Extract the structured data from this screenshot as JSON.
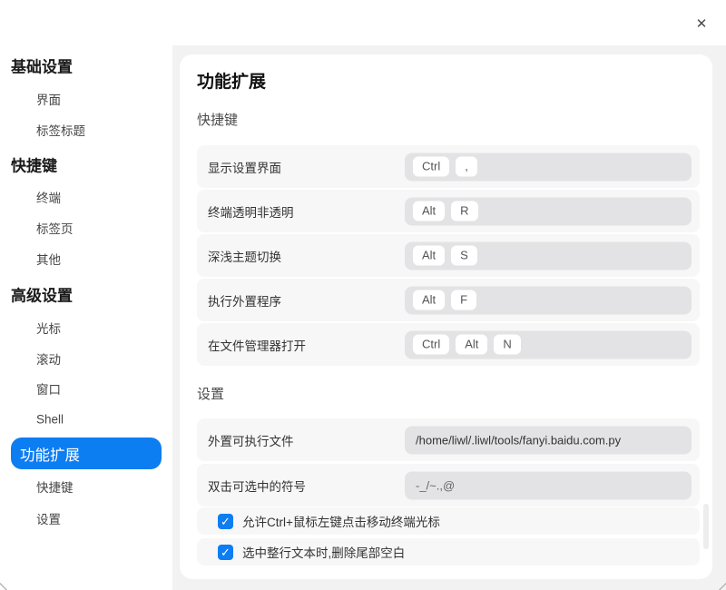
{
  "icons": {
    "close": "✕",
    "check": "✓"
  },
  "colors": {
    "accent": "#0d7df2",
    "row_bg": "#f7f7f8",
    "field_bg": "#e3e3e5",
    "backdrop": "#f2f2f3"
  },
  "sidebar": {
    "items": [
      {
        "label": "基础设置",
        "type": "header"
      },
      {
        "label": "界面",
        "type": "item"
      },
      {
        "label": "标签标题",
        "type": "item"
      },
      {
        "label": "快捷键",
        "type": "header"
      },
      {
        "label": "终端",
        "type": "item"
      },
      {
        "label": "标签页",
        "type": "item"
      },
      {
        "label": "其他",
        "type": "item"
      },
      {
        "label": "高级设置",
        "type": "header"
      },
      {
        "label": "光标",
        "type": "item"
      },
      {
        "label": "滚动",
        "type": "item"
      },
      {
        "label": "窗口",
        "type": "item"
      },
      {
        "label": "Shell",
        "type": "item"
      },
      {
        "label": "功能扩展",
        "type": "selected"
      },
      {
        "label": "快捷键",
        "type": "item"
      },
      {
        "label": "设置",
        "type": "item"
      }
    ]
  },
  "main": {
    "title": "功能扩展",
    "shortcuts_section_title": "快捷键",
    "shortcuts": [
      {
        "label": "显示设置界面",
        "keys": [
          "Ctrl",
          ","
        ]
      },
      {
        "label": "终端透明非透明",
        "keys": [
          "Alt",
          "R"
        ]
      },
      {
        "label": "深浅主题切换",
        "keys": [
          "Alt",
          "S"
        ]
      },
      {
        "label": "执行外置程序",
        "keys": [
          "Alt",
          "F"
        ]
      },
      {
        "label": "在文件管理器打开",
        "keys": [
          "Ctrl",
          "Alt",
          "N"
        ]
      }
    ],
    "settings_section_title": "设置",
    "settings": [
      {
        "label": "外置可执行文件",
        "value": "/home/liwl/.liwl/tools/fanyi.baidu.com.py"
      },
      {
        "label": "双击可选中的符号",
        "value": "-_/~.,@"
      }
    ],
    "checkboxes": [
      {
        "label": "允许Ctrl+鼠标左键点击移动终端光标",
        "checked": true
      },
      {
        "label": "选中整行文本时,删除尾部空白",
        "checked": true
      }
    ]
  }
}
